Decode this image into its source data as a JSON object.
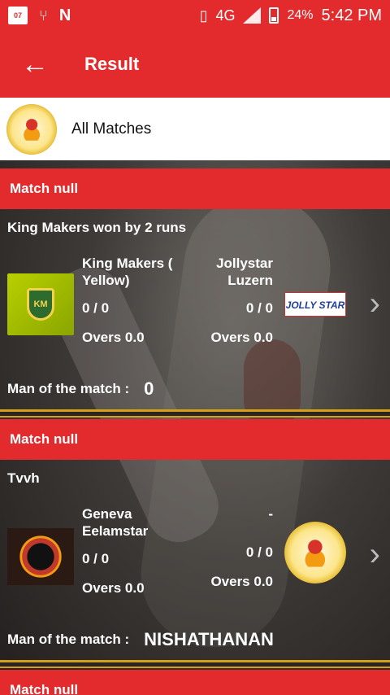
{
  "status_bar": {
    "calendar_day": "07",
    "network": "4G",
    "network_small": "4G",
    "battery": "24%",
    "time": "5:42 PM"
  },
  "app_bar": {
    "title": "Result"
  },
  "filter": {
    "label": "All Matches"
  },
  "matches": [
    {
      "header": "Match null",
      "result": "King Makers won by 2 runs",
      "team_a": {
        "name": "King Makers ( Yellow)",
        "score": "0 / 0",
        "overs": "Overs 0.0",
        "logo_text": "KM"
      },
      "team_b": {
        "name": "Jollystar Luzern",
        "score": "0 / 0",
        "overs": "Overs 0.0",
        "logo_text": "JOLLY STAR"
      },
      "mom_label": "Man of the match :",
      "mom_value": "0"
    },
    {
      "header": "Match null",
      "result": "Tvvh",
      "team_a": {
        "name": "Geneva Eelamstar",
        "score": "0 / 0",
        "overs": "Overs 0.0"
      },
      "team_b": {
        "name": "-",
        "score": "0 / 0",
        "overs": "Overs 0.0"
      },
      "mom_label": "Man of the match :",
      "mom_value": "NISHATHANAN"
    },
    {
      "header": "Match null"
    }
  ],
  "icons": {
    "back": "back-arrow-icon",
    "chevron": "chevron-right-icon"
  }
}
